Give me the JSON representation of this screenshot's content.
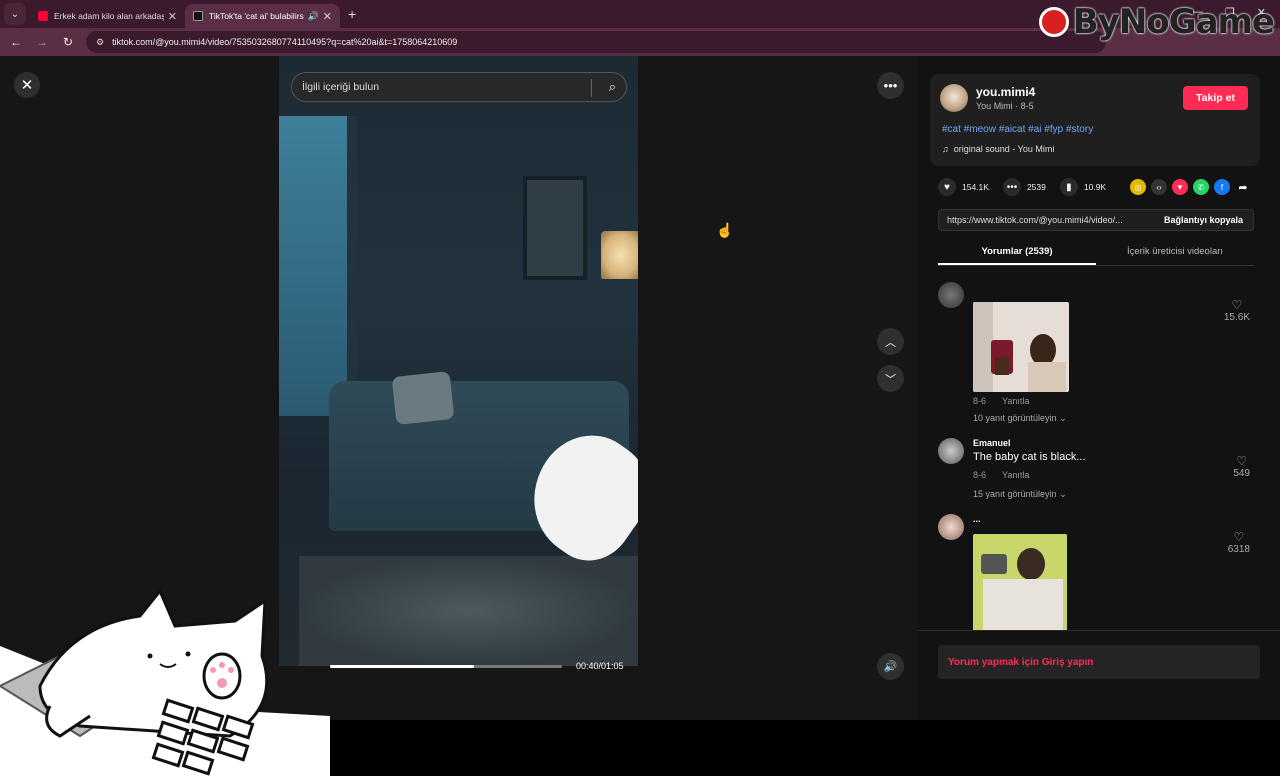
{
  "browser": {
    "tabs": [
      {
        "title": "Erkek adam kilo alan arkadaşına",
        "favicon_color": "#ff0033"
      },
      {
        "title": "TikTok'ta 'cat ai' bulabilirsin",
        "favicon_color": "#111111"
      }
    ],
    "url": "tiktok.com/@you.mimi4/video/7535032680774110495?q=cat%20ai&t=1758064210609"
  },
  "logo": {
    "text": "ByNoGame"
  },
  "player": {
    "search_placeholder": "İlgili içeriği bulun",
    "time": "00:40/01:05",
    "progress": 0.62
  },
  "post": {
    "username": "you.mimi4",
    "subtitle": "You Mimi · 8-5",
    "follow_label": "Takip et",
    "hashtags": "#cat #meow #aicat #ai #fyp #story",
    "sound": "original sound - You Mimi",
    "likes": "154.1K",
    "comments": "2539",
    "saves": "10.9K",
    "link": "https://www.tiktok.com/@you.mimi4/video/...",
    "copy_label": "Bağlantıyı kopyala"
  },
  "tabs": {
    "comments_label": "Yorumlar (2539)",
    "creator_label": "İçerik üreticisi videoları"
  },
  "comments": [
    {
      "name": "",
      "text": "",
      "date": "8-6",
      "reply": "Yanıtla",
      "replies": "10 yanıt görüntüleyin",
      "likes": "15.6K"
    },
    {
      "name": "Emanuel",
      "text": "The baby cat is black...",
      "date": "8-6",
      "reply": "Yanıtla",
      "replies": "15 yanıt görüntüleyin",
      "likes": "549"
    },
    {
      "name": "...",
      "text": "",
      "likes": "6318"
    }
  ],
  "comment_prompt": "Yorum yapmak için Giriş yapın",
  "colors": {
    "accent": "#fe2c55",
    "hashtag": "#6fa6ff",
    "browser": "#5a2f45"
  }
}
